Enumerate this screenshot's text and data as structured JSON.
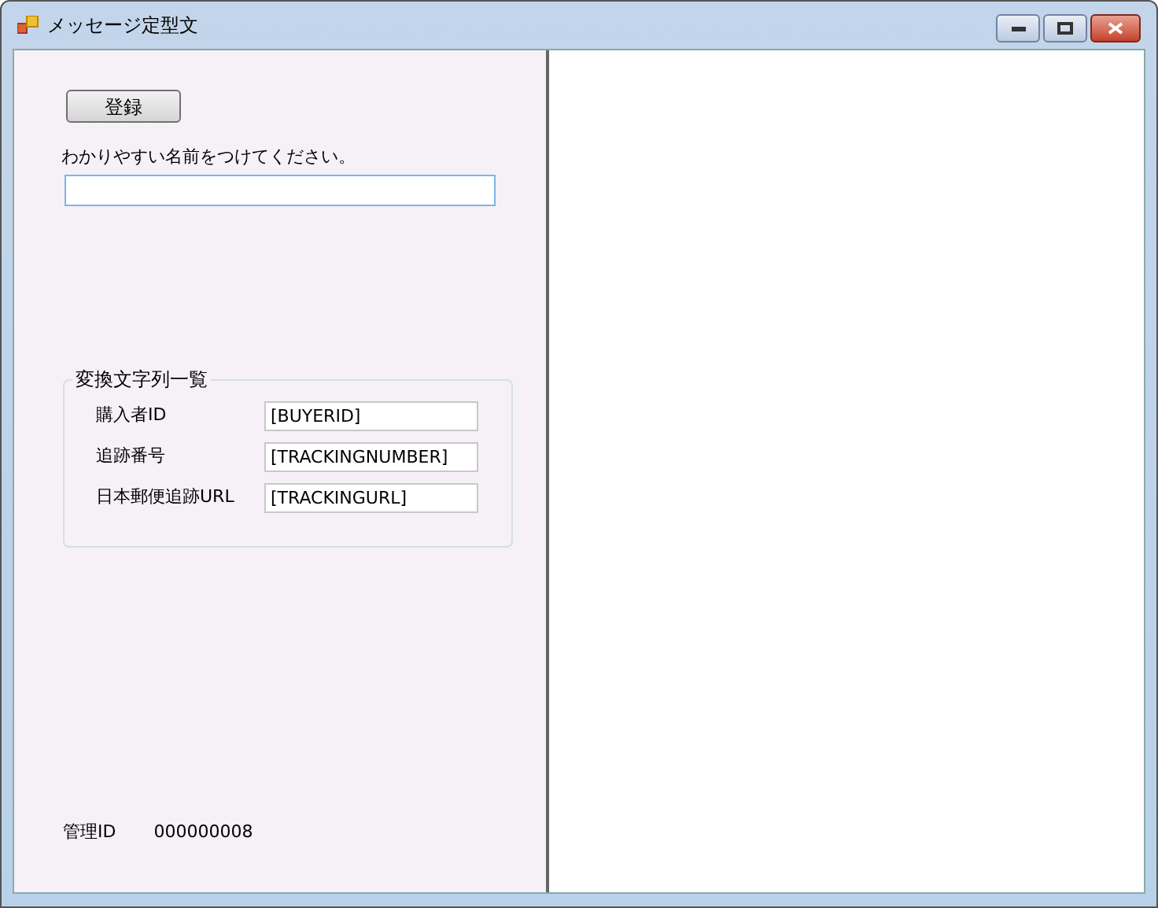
{
  "window": {
    "title": "メッセージ定型文"
  },
  "register_button": {
    "label": "登録"
  },
  "name_prompt": "わかりやすい名前をつけてください。",
  "replacement_group": {
    "title": "変換文字列一覧",
    "rows": [
      {
        "label": "購入者ID",
        "value": "[BUYERID]"
      },
      {
        "label": "追跡番号",
        "value": "[TRACKINGNUMBER]"
      },
      {
        "label": "日本郵便追跡URL",
        "value": "[TRACKINGURL]"
      }
    ]
  },
  "management_id": {
    "label": "管理ID",
    "value": "000000008"
  }
}
